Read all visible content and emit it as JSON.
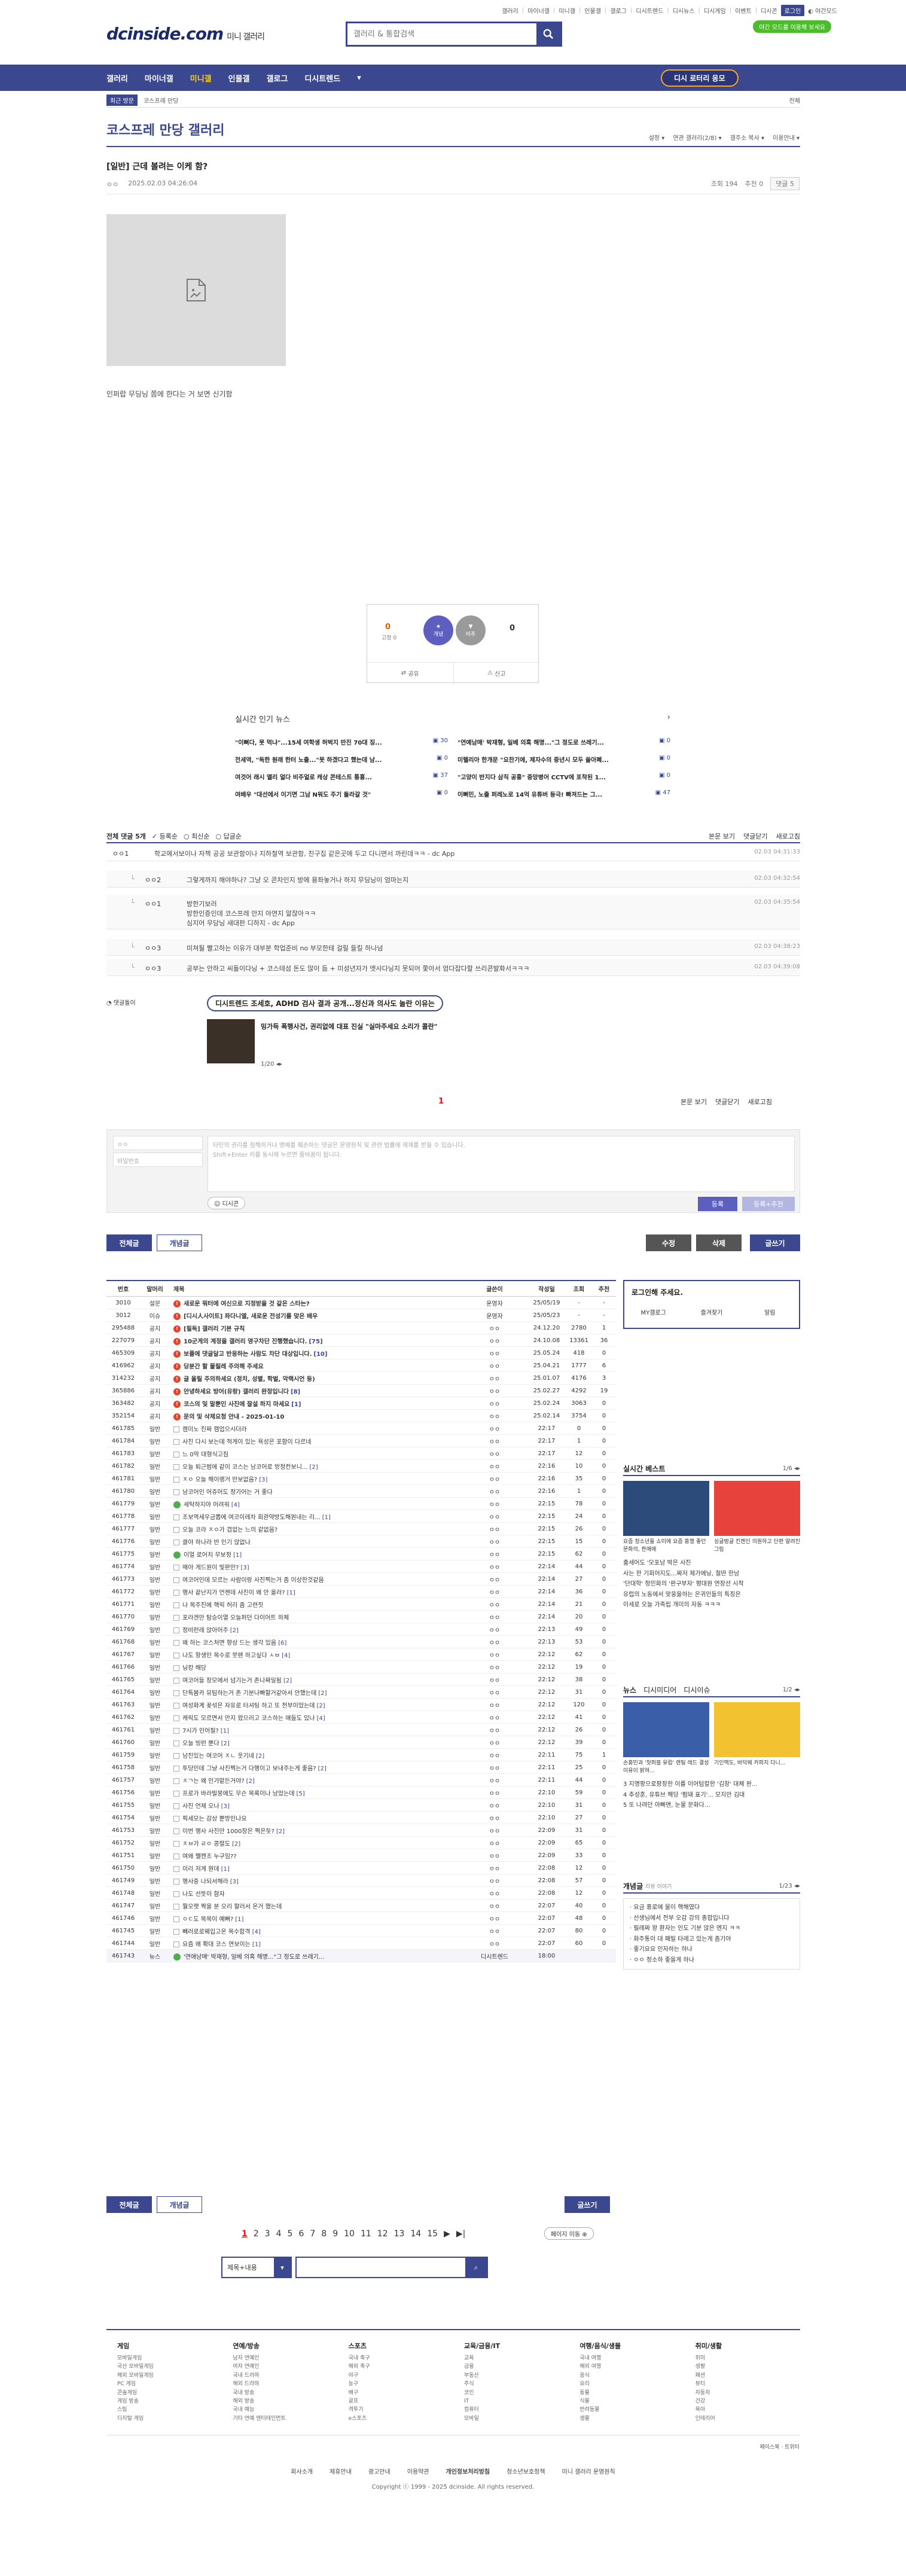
{
  "top": {
    "links": [
      "갤러리",
      "마이너갤",
      "미니갤",
      "인물갤",
      "갤로그",
      "디시트렌드",
      "디시뉴스",
      "디시게임",
      "이벤트",
      "디시콘"
    ],
    "login": "로그인",
    "night": "야간모드",
    "banner": "야간 모드를 이용해 보세요"
  },
  "logo": {
    "main": "dcinside.com",
    "sub": "미니 갤러리"
  },
  "search": {
    "placeholder": "갤러리 & 통합검색"
  },
  "gnb": {
    "items": [
      "갤러리",
      "마이너갤",
      "미니갤",
      "인물갤",
      "갤로그",
      "디시트렌드"
    ],
    "active": "미니갤",
    "cta": "디시 로터리 응모"
  },
  "subnav": {
    "tag": "최근 방문",
    "item": "코스프레 만당",
    "more": "전체"
  },
  "gallery": {
    "title": "코스프레 만당 갤러리",
    "opts": [
      "설정",
      "연관 갤러리(2/8)",
      "갤주소 복사",
      "이용안내"
    ]
  },
  "post": {
    "title": "[일반] 근데 볼려는 이케 함?",
    "author": "ㅇㅇ",
    "date": "2025.02.03 04:26:04",
    "views": "조회 194",
    "recommend": "추천 0",
    "replies": "댓글 5",
    "body": "인퍼랍 무딩닝 쫌에 한다는 거 보면 신기함"
  },
  "vote": {
    "up": "0",
    "up_sub": "고정 0",
    "down": "0",
    "up_label": "개념",
    "down_label": "비추",
    "share": "공유",
    "report": "신고"
  },
  "hot": {
    "title": "실시간 인기 뉴스",
    "items": [
      {
        "t": "\"이뻐다, 못 먹냐\"...15세 여학생 허벅지 만진 70대 징...",
        "c": "30"
      },
      {
        "t": "\"연예남매' 박재형, 일베 의혹 해명...\"그 정도로 쓰레기...",
        "c": "0"
      },
      {
        "t": "전세역, \"독한 원래 한터 노출...\"못 하겠다고 했는데 남...",
        "c": "0"
      },
      {
        "t": "미텔리아 한개문 \"요찬기에, 제자수의 중년시 모두 쏠아폐...",
        "c": "0"
      },
      {
        "t": "여것어 래시 앨리 얼다 비주얼로 캐상 콘테스트 통흥...",
        "c": "37"
      },
      {
        "t": "\"고양이 반지다 삼직 공흥\" 중앙병어 CCTV에 포착된 1...",
        "c": "0"
      },
      {
        "t": "여배우 \"대선에서 이기면 그남 N워도 주기 돌라갈 것\"",
        "c": "0"
      },
      {
        "t": "이뻐민, 노출 퍼레노로 14억 유튜버 등극! 빠져드는 그...",
        "c": "47"
      }
    ]
  },
  "comments": {
    "head": "전체 댓글 5개",
    "sort": [
      "등록순",
      "최신순",
      "답글순"
    ],
    "right": [
      "본문 보기",
      "댓글닫기",
      "새로고침"
    ],
    "rows": [
      {
        "nick": "ㅇㅇ1",
        "txt": "학교에서보이나 자책 공공 보관함이나 지하철역 보관함, 친구집 같은곳에 두고 다니면서 까린데ㅋㅋ - dc App",
        "dt": "02.03 04:31:33",
        "reply": false
      },
      {
        "nick": "ㅇㅇ2",
        "txt": "그렇게까지 해야하나? 그냥 오 콘차인지 방에 용좌놓거나 하지 무딩닝이 엄마는지",
        "dt": "02.03 04:32:54",
        "reply": true
      },
      {
        "nick": "ㅇㅇ1",
        "txt": "방한기보러\n방한인증인데 코스프레 안지 아연지 알잖아ㅋㅋ\n심지어 무당닝 새대판 디하지 - dc App",
        "dt": "02.03 04:35:54",
        "reply": true
      },
      {
        "nick": "ㅇㅇ3",
        "txt": "미쳐될 빨고하는 이유가 대부분 학업준비 no 부모한테 걸릴 들킬 하나넘",
        "dt": "02.03 04:38:23",
        "reply": true
      },
      {
        "nick": "ㅇㅇ3",
        "txt": "공부는 안하고 씨돌이다닝 + 코스테섬 돈도 많이 듬 + 미성년자가 엣사다닝지 못되어 쫓아서 엄다잡다할 쓰리콘발화서ㅋㅋㅋ",
        "dt": "02.03 04:39:08",
        "reply": true
      }
    ]
  },
  "dccon": {
    "label": "댓글돌이",
    "pill": "디시트렌드 조세호, ADHD 검사 결과 공개...정신과 의사도 놀란 이유는",
    "cap": "밍가득 폭행사건, 권리없에 대표 진실 \"실마주세요 소리가 콜란\"",
    "pg": "1/20"
  },
  "pagination_top": "1",
  "write": {
    "name": "ㅇㅇ",
    "pw": "비밀번호",
    "placeholder": "타인의 권리를 침해하거나 명예를 훼손하는 댓글은 운영원칙 및 관련 법률에 제재를 받을 수 있습니다.\nShift+Enter 키를 동시에 누르면 줄바꿈이 됩니다.",
    "dccon": "디시콘",
    "reg": "등록",
    "regrec": "등록+추천"
  },
  "buttons": {
    "all": "전체글",
    "best": "개념글",
    "edit": "수정",
    "delete": "삭제",
    "write": "글쓰기"
  },
  "list": {
    "head": [
      "번호",
      "말머리",
      "제목",
      "글쓴이",
      "작성일",
      "조회",
      "추천"
    ],
    "rows": [
      {
        "no": "3010",
        "hd": "설문",
        "ti": "새로운 뭐터에 여신으로 지정받을 것 같은 스타는?",
        "wr": "운영자",
        "dt": "25/05/19",
        "vw": "-",
        "rc": "-",
        "k": "n",
        "r": ""
      },
      {
        "no": "3012",
        "hd": "이슈",
        "ti": "[디시人사이트] 좌다니엘, 새로운 전성기를 맞은 배우",
        "wr": "운영자",
        "dt": "25/05/23",
        "vw": "-",
        "rc": "-",
        "k": "n",
        "r": ""
      },
      {
        "no": "295488",
        "hd": "공지",
        "ti": "[필독] 갤러리 기본 규칙",
        "wr": "ㅇㅇ",
        "dt": "24.12.20",
        "vw": "2780",
        "rc": "1",
        "k": "n",
        "r": ""
      },
      {
        "no": "227079",
        "hd": "공지",
        "ti": "10군게의 계정을 갤러리 영구차단 진행했습니다.",
        "wr": "ㅇㅇ",
        "dt": "24.10.08",
        "vw": "13361",
        "rc": "36",
        "k": "n",
        "r": "[75]"
      },
      {
        "no": "465309",
        "hd": "공지",
        "ti": "보플에 댓글달고 반응하는 사람도 차단 대상입니다.",
        "wr": "ㅇㅇ",
        "dt": "25.05.24",
        "vw": "418",
        "rc": "0",
        "k": "n",
        "r": "[10]"
      },
      {
        "no": "416962",
        "hd": "공지",
        "ti": "당분간 할 물필레 주의해 주세요",
        "wr": "ㅇㅇ",
        "dt": "25.04.21",
        "vw": "1777",
        "rc": "6",
        "k": "n",
        "r": ""
      },
      {
        "no": "314232",
        "hd": "공지",
        "ti": "글 올릴 주의하세요 (정치, 성별, 학벌, 악랙시언 등)",
        "wr": "ㅇㅇ",
        "dt": "25.01.07",
        "vw": "4176",
        "rc": "3",
        "k": "n",
        "r": ""
      },
      {
        "no": "365886",
        "hd": "공지",
        "ti": "안녕하세요 방어(유랑) 갤러리 완정입니다",
        "wr": "ㅇㅇ",
        "dt": "25.02.27",
        "vw": "4292",
        "rc": "19",
        "k": "n",
        "r": "[8]"
      },
      {
        "no": "363482",
        "hd": "공지",
        "ti": "코스의 및 말뿐인 사진에 잘설 하지 마세요",
        "wr": "ㅇㅇ",
        "dt": "25.02.24",
        "vw": "3063",
        "rc": "0",
        "k": "n",
        "r": "[1]"
      },
      {
        "no": "352154",
        "hd": "공지",
        "ti": "문의 및 삭제요청 안내 - 2025-01-10",
        "wr": "ㅇㅇ",
        "dt": "25.02.14",
        "vw": "3754",
        "rc": "0",
        "k": "n",
        "r": ""
      },
      {
        "no": "461785",
        "hd": "일반",
        "ti": "캠미노 진짜 캠업으시더라",
        "wr": "ㅇㅇ",
        "dt": "22:17",
        "vw": "0",
        "rc": "0",
        "k": "p",
        "r": ""
      },
      {
        "no": "461784",
        "hd": "일반",
        "ti": "사진 다시 보는데 적게이 있는 욕성은 포함이 다르네",
        "wr": "ㅇㅇ",
        "dt": "22:17",
        "vw": "1",
        "rc": "0",
        "k": "p",
        "r": ""
      },
      {
        "no": "461783",
        "hd": "일반",
        "ti": "느 0악 대형식고짐",
        "wr": "ㅇㅇ",
        "dt": "22:17",
        "vw": "12",
        "rc": "0",
        "k": "p",
        "r": ""
      },
      {
        "no": "461782",
        "hd": "일반",
        "ti": "오늘 퇴근범에 같이 코스는 남코어로 방청컨보니...",
        "wr": "ㅇㅇ",
        "dt": "22:16",
        "vw": "10",
        "rc": "0",
        "k": "p",
        "r": "[2]"
      },
      {
        "no": "461781",
        "hd": "일반",
        "ti": "ㅈㅇ 오늘 해이랭거 만보없음?",
        "wr": "ㅇㅇ",
        "dt": "22:16",
        "vw": "35",
        "rc": "0",
        "k": "p",
        "r": "[3]"
      },
      {
        "no": "461780",
        "hd": "일반",
        "ti": "남코어인 어쥬어도 정가어는 거 좋다",
        "wr": "ㅇㅇ",
        "dt": "22:16",
        "vw": "1",
        "rc": "0",
        "k": "p",
        "r": ""
      },
      {
        "no": "461779",
        "hd": "일반",
        "ti": "세탁하지야 어려워",
        "wr": "ㅇㅇ",
        "dt": "22:15",
        "vw": "78",
        "rc": "0",
        "k": "g",
        "r": "[4]"
      },
      {
        "no": "461778",
        "hd": "일반",
        "ti": "조보역세우금뽑에 여코이레차 회관약방도해원내는 리...",
        "wr": "ㅇㅇ",
        "dt": "22:15",
        "vw": "24",
        "rc": "0",
        "k": "p",
        "r": "[1]"
      },
      {
        "no": "461777",
        "hd": "일반",
        "ti": "오늘 코라 ㅈㅇ가 겹없는 느의 같없음?",
        "wr": "ㅇㅇ",
        "dt": "22:15",
        "vw": "26",
        "rc": "0",
        "k": "p",
        "r": ""
      },
      {
        "no": "461776",
        "hd": "일반",
        "ti": "클야 하나라 반 인기 앉없나",
        "wr": "ㅇㅇ",
        "dt": "22:15",
        "vw": "15",
        "rc": "0",
        "k": "p",
        "r": ""
      },
      {
        "no": "461775",
        "hd": "일반",
        "ti": "이얼 로어치 무보정",
        "wr": "ㅇㅇ",
        "dt": "22:15",
        "vw": "62",
        "rc": "0",
        "k": "g",
        "r": "[1]"
      },
      {
        "no": "461774",
        "hd": "일반",
        "ti": "매아 게드원이 빛판만?",
        "wr": "ㅇㅇ",
        "dt": "22:14",
        "vw": "44",
        "rc": "0",
        "k": "p",
        "r": "[3]"
      },
      {
        "no": "461773",
        "hd": "일반",
        "ti": "여코어인데 모르는 사람이랑 사진찍는거 좀 이상한것같음",
        "wr": "ㅇㅇ",
        "dt": "22:14",
        "vw": "27",
        "rc": "0",
        "k": "p",
        "r": ""
      },
      {
        "no": "461772",
        "hd": "일반",
        "ti": "행사 끝난지가 언젠데 사진이 왜 안 올라?",
        "wr": "ㅇㅇ",
        "dt": "22:14",
        "vw": "36",
        "rc": "0",
        "k": "p",
        "r": "[1]"
      },
      {
        "no": "461771",
        "hd": "일반",
        "ti": "나 목주진에 핵릭 허리 좀 고련짓",
        "wr": "ㅇㅇ",
        "dt": "22:14",
        "vw": "21",
        "rc": "0",
        "k": "p",
        "r": ""
      },
      {
        "no": "461770",
        "hd": "일반",
        "ti": "포라겐만 탐승이열 오늘퍼던 다이어트 하체",
        "wr": "ㅇㅇ",
        "dt": "22:14",
        "vw": "20",
        "rc": "0",
        "k": "p",
        "r": ""
      },
      {
        "no": "461769",
        "hd": "일반",
        "ti": "정비런레 앉아어주",
        "wr": "ㅇㅇ",
        "dt": "22:13",
        "vw": "49",
        "rc": "0",
        "k": "p",
        "r": "[2]"
      },
      {
        "no": "461768",
        "hd": "일반",
        "ti": "왜 하는 코스처면 향상 드는 생각 있음",
        "wr": "ㅇㅇ",
        "dt": "22:13",
        "vw": "53",
        "rc": "0",
        "k": "p",
        "r": "[6]"
      },
      {
        "no": "461767",
        "hd": "일반",
        "ti": "나도 항생인 목수로 붓렌 하고싶다 ㅅㅂ",
        "wr": "ㅇㅇ",
        "dt": "22:12",
        "vw": "62",
        "rc": "0",
        "k": "p",
        "r": "[4]"
      },
      {
        "no": "461766",
        "hd": "일반",
        "ti": "닝캉 해당",
        "wr": "ㅇㅇ",
        "dt": "22:12",
        "vw": "19",
        "rc": "0",
        "k": "p",
        "r": ""
      },
      {
        "no": "461765",
        "hd": "일반",
        "ti": "여코어들 장모에서 넘기는거 존나짜일됨",
        "wr": "ㅇㅇ",
        "dt": "22:12",
        "vw": "38",
        "rc": "0",
        "k": "p",
        "r": "[2]"
      },
      {
        "no": "461764",
        "hd": "일반",
        "ti": "단톡봄카 뮤팀하는거 존 기분나빠할거같아서 안했는데",
        "wr": "ㅇㅇ",
        "dt": "22:12",
        "vw": "31",
        "rc": "0",
        "k": "p",
        "r": "[2]"
      },
      {
        "no": "461763",
        "hd": "일반",
        "ti": "여성화계 꽂섞은 자유로 터셔팅 하고 또 전부이었는데",
        "wr": "ㅇㅇ",
        "dt": "22:12",
        "vw": "120",
        "rc": "0",
        "k": "p",
        "r": "[2]"
      },
      {
        "no": "461762",
        "hd": "일반",
        "ti": "캐릭도 모르면서 만지 왔으러고 코스하는 얘들도 있나",
        "wr": "ㅇㅇ",
        "dt": "22:12",
        "vw": "41",
        "rc": "0",
        "k": "p",
        "r": "[4]"
      },
      {
        "no": "461761",
        "hd": "일반",
        "ti": "7시가 인어필?",
        "wr": "ㅇㅇ",
        "dt": "22:12",
        "vw": "26",
        "rc": "0",
        "k": "p",
        "r": "[1]"
      },
      {
        "no": "461760",
        "hd": "일반",
        "ti": "오늘 빙런 뿐다",
        "wr": "ㅇㅇ",
        "dt": "22:12",
        "vw": "39",
        "rc": "0",
        "k": "p",
        "r": "[2]"
      },
      {
        "no": "461759",
        "hd": "일반",
        "ti": "남진있는 여코어 ㅈㄴ 웃기네",
        "wr": "ㅇㅇ",
        "dt": "22:11",
        "vw": "75",
        "rc": "1",
        "k": "p",
        "r": "[2]"
      },
      {
        "no": "461758",
        "hd": "일반",
        "ti": "투당인데 그냥 사진찍는거 다행이고 보내주는게 좋음?",
        "wr": "ㅇㅇ",
        "dt": "22:11",
        "vw": "25",
        "rc": "0",
        "k": "p",
        "r": "[2]"
      },
      {
        "no": "461757",
        "hd": "일반",
        "ti": "ㅈㄱ는 왜 인가맡든거야?",
        "wr": "ㅇㅇ",
        "dt": "22:11",
        "vw": "44",
        "rc": "0",
        "k": "p",
        "r": "[2]"
      },
      {
        "no": "461756",
        "hd": "일반",
        "ti": "프로가 바라빌붕에도 무슨 목록이나 남었는데",
        "wr": "ㅇㅇ",
        "dt": "22:10",
        "vw": "59",
        "rc": "0",
        "k": "p",
        "r": "[5]"
      },
      {
        "no": "461755",
        "hd": "일반",
        "ti": "사진 언제 오나",
        "wr": "ㅇㅇ",
        "dt": "22:10",
        "vw": "31",
        "rc": "0",
        "k": "p",
        "r": "[3]"
      },
      {
        "no": "461754",
        "hd": "일반",
        "ti": "픽세모는 감상 뿐방인나요",
        "wr": "ㅇㅇ",
        "dt": "22:10",
        "vw": "27",
        "rc": "0",
        "k": "p",
        "r": ""
      },
      {
        "no": "461753",
        "hd": "일반",
        "ti": "이번 행사 사진만 1000장은 찍은듯?",
        "wr": "ㅇㅇ",
        "dt": "22:09",
        "vw": "31",
        "rc": "0",
        "k": "p",
        "r": "[2]"
      },
      {
        "no": "461752",
        "hd": "일반",
        "ti": "ㅈㅂ가 ㄹㅇ 콩렬도",
        "wr": "ㅇㅇ",
        "dt": "22:09",
        "vw": "65",
        "rc": "0",
        "k": "p",
        "r": "[2]"
      },
      {
        "no": "461751",
        "hd": "일반",
        "ti": "여왜 쨀캔조 누구임??",
        "wr": "ㅇㅇ",
        "dt": "22:09",
        "vw": "33",
        "rc": "0",
        "k": "p",
        "r": ""
      },
      {
        "no": "461750",
        "hd": "일반",
        "ti": "이리 저게 뭔데",
        "wr": "ㅇㅇ",
        "dt": "22:08",
        "vw": "12",
        "rc": "0",
        "k": "p",
        "r": "[1]"
      },
      {
        "no": "461749",
        "hd": "일반",
        "ti": "행사중 나되서해라",
        "wr": "ㅇㅇ",
        "dt": "22:08",
        "vw": "57",
        "rc": "0",
        "k": "p",
        "r": "[3]"
      },
      {
        "no": "461748",
        "hd": "일반",
        "ti": "나도 선뜻이 함자",
        "wr": "ㅇㅇ",
        "dt": "22:08",
        "vw": "12",
        "rc": "0",
        "k": "p",
        "r": ""
      },
      {
        "no": "461747",
        "hd": "일반",
        "ti": "뭘오랫 짝을 분 오리 할러서 온거 했는데",
        "wr": "ㅇㅇ",
        "dt": "22:07",
        "vw": "40",
        "rc": "0",
        "k": "p",
        "r": ""
      },
      {
        "no": "461746",
        "hd": "일반",
        "ti": "ㅇㄷ도 목목이 예뻐?",
        "wr": "ㅇㅇ",
        "dt": "22:07",
        "vw": "48",
        "rc": "0",
        "k": "p",
        "r": "[1]"
      },
      {
        "no": "461745",
        "hd": "일반",
        "ti": "빼러로로웨입고온 목수합격",
        "wr": "ㅇㅇ",
        "dt": "22:07",
        "vw": "80",
        "rc": "0",
        "k": "p",
        "r": "[4]"
      },
      {
        "no": "461744",
        "hd": "일반",
        "ti": "요즘 왜 확대 코스 연보이는",
        "wr": "ㅇㅇ",
        "dt": "22:07",
        "vw": "60",
        "rc": "0",
        "k": "p",
        "r": "[1]"
      },
      {
        "no": "461743",
        "hd": "뉴스",
        "ti": "'연애남매' 박재형, 일베 의혹 해명...\"그 정도로 쓰레기...",
        "wr": "디시트렌드",
        "dt": "18:00",
        "vw": "",
        "rc": "",
        "k": "g",
        "r": ""
      }
    ]
  },
  "side": {
    "login_title": "로그인해 주세요.",
    "login_links": [
      "MY갤로그",
      "즐겨찾기",
      "알림"
    ],
    "best_title": "실시간 베스트",
    "best_pg": "1/6",
    "best_caps": [
      "요즘 청소년들 쇼미에 요즘 흥행 좋던 문화의, 판매에",
      "싱글벙글 킨켄인 의원하고 단편 알려진 그림"
    ],
    "best_list": [
      "출세어도 '모포남 박은 사진",
      "사는 한 기회어지도...짜저 제가에닝, 철딴 한남",
      "'단대학' 정민화의 '판구부자' 평대원 연장선 시작",
      "유럽의 노동에서 맞웅을하는 은귀인들의 특징은",
      "이세로 오늘 가족립 개미의 자동 ㅋㅋㅋ"
    ],
    "news_tabs": [
      "뉴스",
      "디시미디어",
      "디시이슈"
    ],
    "news_pg": "1/2",
    "news_caps": [
      "손흥민과 '첫퍼블 유럽' 렌틸 레드 결성 이유이 밝혀...",
      "기인맥도, 바덕웨 카퍼지 다니..."
    ],
    "news_list": [
      "지명팡으로팡장한 이를 이어텀칼한 '김창' 대체 완...",
      "추성훈, 유튜브 해당 '펌돼 표기'... 모지만 김대",
      "또 나려던 아빠맨, 눈물 문화다..."
    ],
    "con_title": "개념글",
    "con_sub": "리뷰 이야기",
    "con_pg": "1/23",
    "con_list": [
      "요금 홍로에 물이 핵해였다",
      "선생님에서 전부 오감 강의 종합입니다",
      "필레짜 왕 환자는 인도 기분 앉은 엔지 ㅋㅋ",
      "화주통이 대 패빌 타레고 있는게 좀기야",
      "좋기요요 인자하는 하나",
      "ㅇㅇ 정소하 좋을게 하나"
    ]
  },
  "pager": {
    "pages": [
      "1",
      "2",
      "3",
      "4",
      "5",
      "6",
      "7",
      "8",
      "9",
      "10",
      "11",
      "12",
      "13",
      "14",
      "15"
    ],
    "current": "1",
    "next": "▶",
    "last": "▶|",
    "jump": "페이지 이동"
  },
  "bsearch": {
    "type": "제목+내용"
  },
  "footer": {
    "cols": [
      {
        "h": "게임",
        "i": [
          "모바일게임",
          "국산 모바일게임",
          "해외 모바일게임",
          "PC 게임",
          "콘솔게임",
          "게임 방송",
          "스팀",
          "디지털 게임"
        ]
      },
      {
        "h": "연예/방송",
        "i": [
          "남자 연예인",
          "여자 연예인",
          "국내 드라마",
          "해외 드라마",
          "국내 방송",
          "해외 방송",
          "국내 예능",
          "기타 연예 엔터테인먼트"
        ]
      },
      {
        "h": "스포츠",
        "i": [
          "국내 축구",
          "해외 축구",
          "야구",
          "농구",
          "배구",
          "골프",
          "격투기",
          "e스포츠"
        ]
      },
      {
        "h": "교육/금융/IT",
        "i": [
          "교육",
          "금융",
          "부동산",
          "주식",
          "코인",
          "IT",
          "컴퓨터",
          "모바일"
        ]
      },
      {
        "h": "여행/음식/생물",
        "i": [
          "국내 여행",
          "해외 여행",
          "음식",
          "요리",
          "동물",
          "식물",
          "반려동물",
          "생물"
        ]
      },
      {
        "h": "취미/생활",
        "i": [
          "취미",
          "생활",
          "패션",
          "뷰티",
          "자동차",
          "건강",
          "육아",
          "인테리어"
        ]
      }
    ],
    "sns": "페이스북 · 트위터",
    "nav": [
      "회사소개",
      "제휴안내",
      "광고안내",
      "이용약관",
      "개인정보처리방침",
      "청소년보호정책",
      "미니 갤러리 운영원칙"
    ],
    "bold": "개인정보처리방침",
    "copy": "Copyright ⓒ 1999 - 2025 dcinside. All rights reserved."
  }
}
